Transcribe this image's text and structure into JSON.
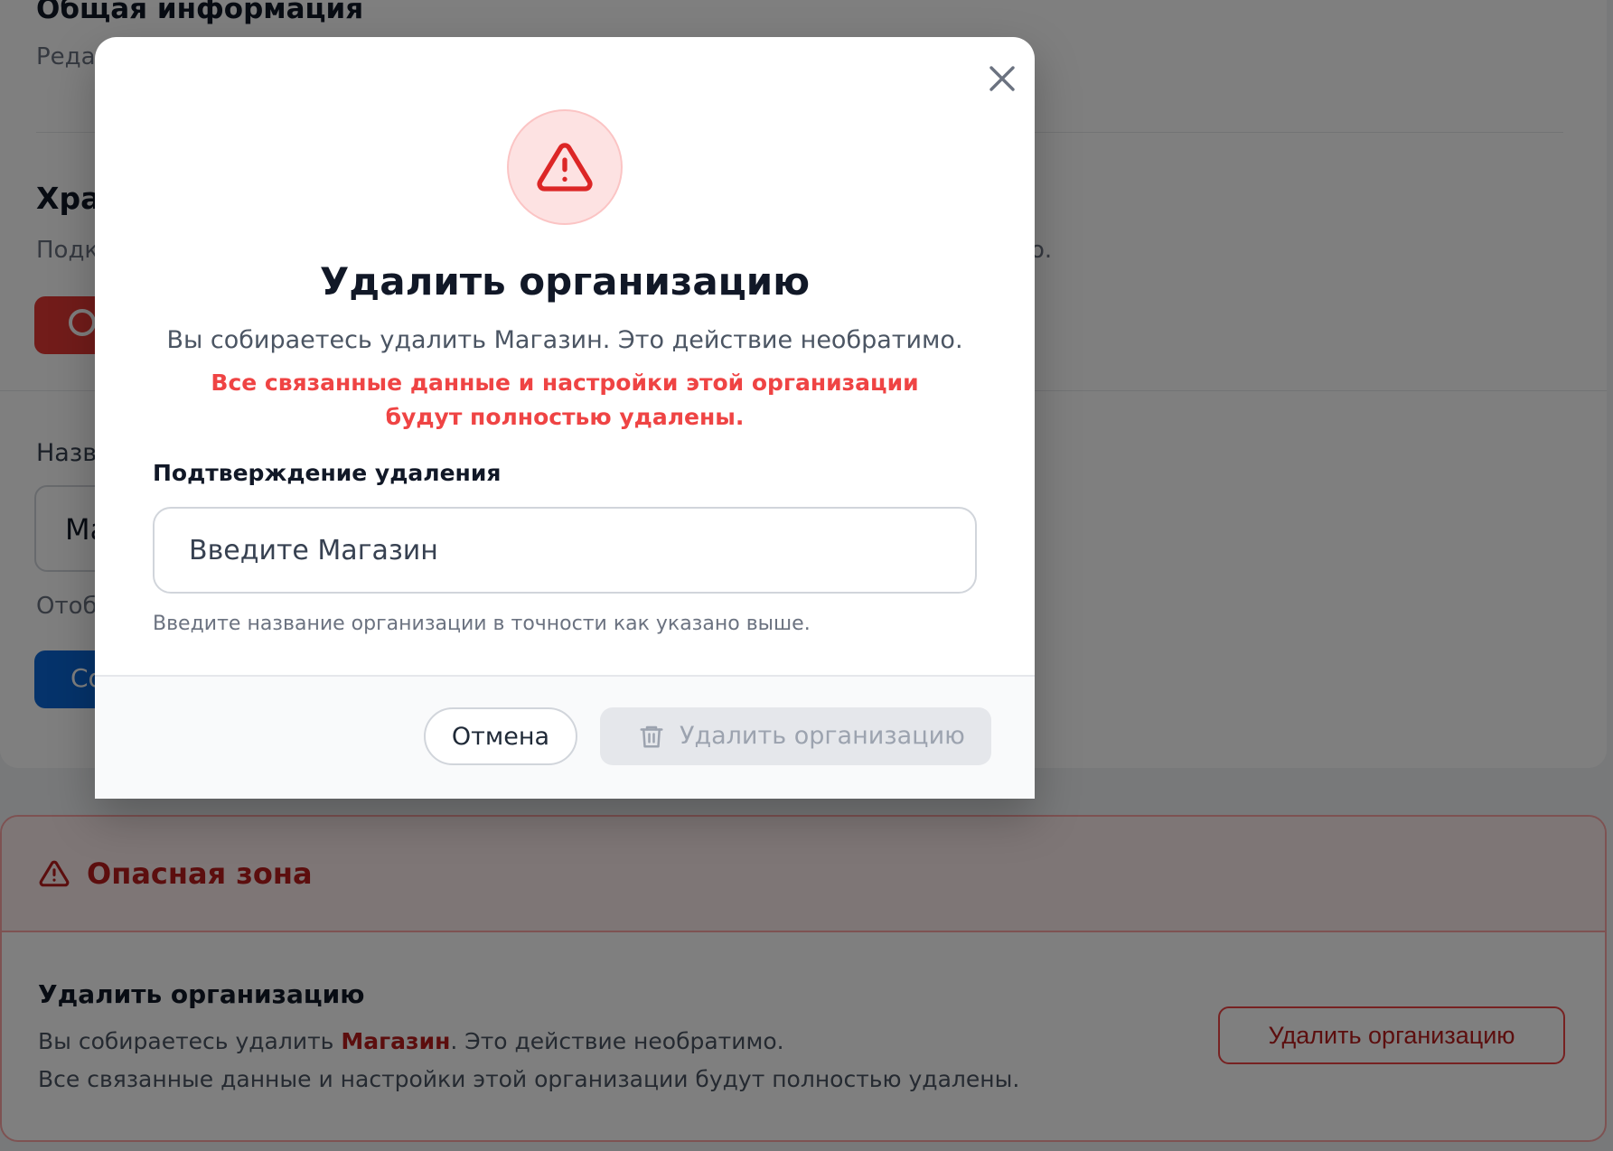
{
  "background": {
    "general_title": "Общая информация",
    "general_sub": "Реда",
    "storage_title": "Хра",
    "storage_sub": "Подк",
    "storage_tail": "о.",
    "name_label": "Назв",
    "name_value": "Ма",
    "name_hint": "Отоб",
    "save_button": "Со"
  },
  "danger_zone": {
    "title": "Опасная зона",
    "delete_title": "Удалить организацию",
    "line1_prefix": "Вы собираетесь удалить ",
    "line1_name": "Магазин",
    "line1_suffix": ". Это действие необратимо.",
    "line2": "Все связанные данные и настройки этой организации будут полностью удалены.",
    "delete_button": "Удалить организацию"
  },
  "modal": {
    "title": "Удалить организацию",
    "description": "Вы собираетесь удалить Магазин. Это действие необратимо.",
    "warning": "Все связанные данные и настройки этой организации будут полностью удалены.",
    "confirm_label": "Подтверждение удаления",
    "confirm_placeholder": "Введите Магазин",
    "confirm_value": "",
    "confirm_hint": "Введите название организации в точности как указано выше.",
    "cancel_button": "Отмена",
    "delete_button": "Удалить организацию"
  },
  "colors": {
    "danger": "#ef4444",
    "danger_dark": "#b91c1c",
    "primary": "#0b66d6",
    "disabled_bg": "#e5e7eb"
  },
  "icons": {
    "close": "close-icon",
    "alert": "warning-triangle-icon",
    "trash": "trash-icon"
  }
}
